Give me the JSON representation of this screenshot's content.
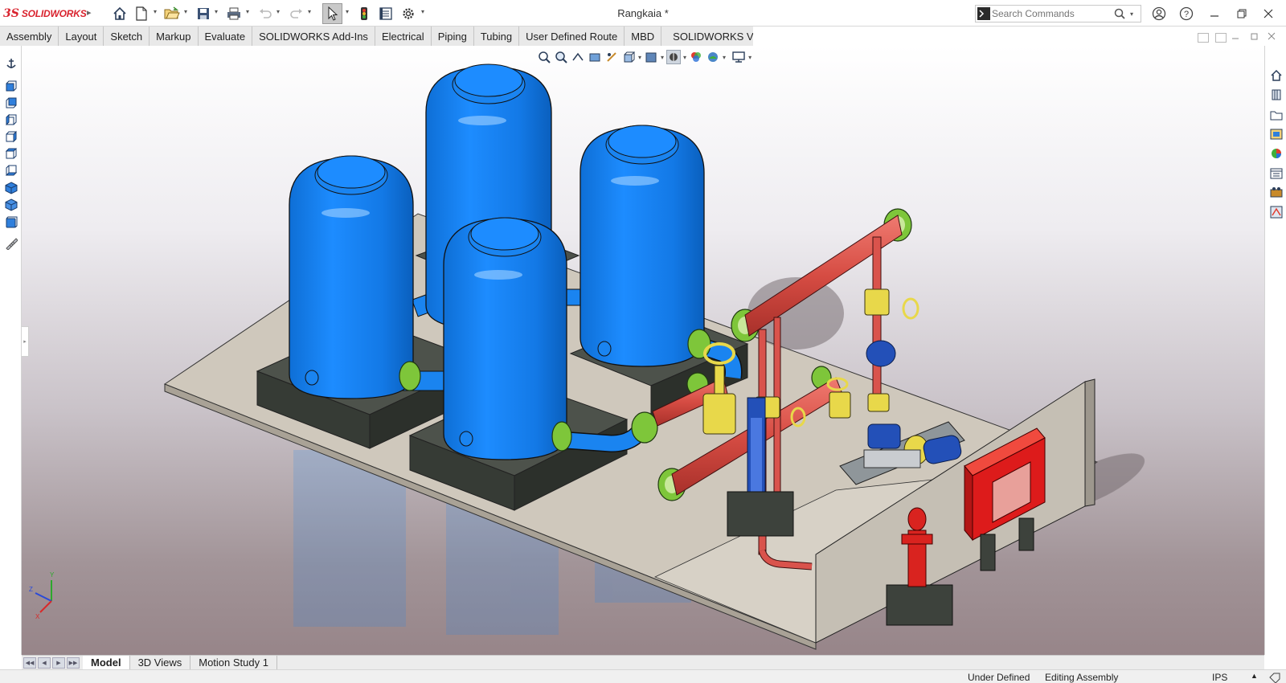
{
  "app": {
    "brand_ds": "3S",
    "brand_name": "SOLIDWORKS",
    "document_title": "Rangkaia *"
  },
  "quick_access": [
    {
      "icon": "home-icon"
    },
    {
      "icon": "new-document-icon"
    },
    {
      "icon": "open-folder-icon"
    },
    {
      "icon": "save-icon"
    },
    {
      "icon": "print-icon"
    },
    {
      "icon": "undo-icon"
    },
    {
      "icon": "redo-icon"
    },
    {
      "icon": "select-cursor-icon"
    },
    {
      "icon": "rebuild-traffic-light-icon"
    },
    {
      "icon": "file-properties-icon"
    },
    {
      "icon": "options-gear-icon"
    }
  ],
  "search": {
    "placeholder": "Search Commands"
  },
  "window_controls": [
    "user-account-icon",
    "help-icon",
    "minimize-icon",
    "restore-icon",
    "close-icon"
  ],
  "command_tabs": [
    "Assembly",
    "Layout",
    "Sketch",
    "Markup",
    "Evaluate",
    "SOLIDWORKS Add-Ins",
    "Electrical",
    "Piping",
    "Tubing",
    "User Defined Route",
    "MBD",
    "SOLIDWORKS Visualize"
  ],
  "bottom_tabs": [
    "Model",
    "3D Views",
    "Motion Study 1"
  ],
  "active_bottom_tab": "Model",
  "status": {
    "definition": "Under Defined",
    "mode": "Editing Assembly",
    "units": "IPS"
  },
  "colors": {
    "tank_blue": "#1a84f0",
    "pipe_red": "#d9534c",
    "flange_green": "#7ec63a",
    "valve_yellow": "#e8d84a",
    "cabinet_red": "#dd1b1b",
    "pad_dark": "#464b45",
    "slab": "#cfc8bc",
    "brand_red": "#d9232e"
  }
}
